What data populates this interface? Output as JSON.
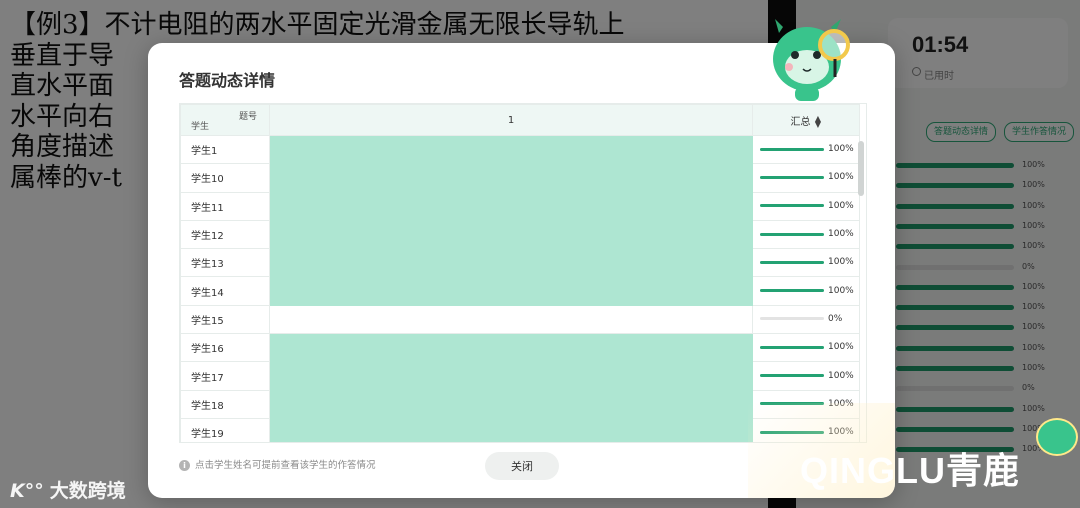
{
  "slide": {
    "text": "【例3】不计电阻的两水平固定光滑金属无限长导轨上\n  垂直于导\n  直水平面\n  水平向右\n  角度描述\n  属棒的v-t"
  },
  "timer": {
    "value": "01:54",
    "label": "已用时"
  },
  "right_panel": {
    "tabs": [
      "答题动态详情",
      "学生作答情况"
    ],
    "rows": [
      {
        "pct": "100%",
        "v": 1
      },
      {
        "pct": "100%",
        "v": 1
      },
      {
        "pct": "100%",
        "v": 1
      },
      {
        "pct": "100%",
        "v": 1
      },
      {
        "pct": "100%",
        "v": 1
      },
      {
        "pct": "0%",
        "v": 0
      },
      {
        "pct": "100%",
        "v": 1
      },
      {
        "pct": "100%",
        "v": 1
      },
      {
        "pct": "100%",
        "v": 1
      },
      {
        "pct": "100%",
        "v": 1
      },
      {
        "pct": "100%",
        "v": 1
      },
      {
        "pct": "0%",
        "v": 0
      },
      {
        "pct": "100%",
        "v": 1
      },
      {
        "pct": "100%",
        "v": 1
      },
      {
        "pct": "100%",
        "v": 1
      }
    ]
  },
  "watermark": {
    "left": "大数跨境",
    "left_logo": "K°°",
    "right": "QINGLU青鹿"
  },
  "modal": {
    "title": "答题动态详情",
    "header": {
      "question_label": "题号",
      "student_label": "学生",
      "question_number": "1",
      "summary_label": "汇总"
    },
    "students": [
      {
        "name": "学生1",
        "answered": true,
        "rate": 1,
        "pct": "100%"
      },
      {
        "name": "学生10",
        "answered": true,
        "rate": 1,
        "pct": "100%"
      },
      {
        "name": "学生11",
        "answered": true,
        "rate": 1,
        "pct": "100%"
      },
      {
        "name": "学生12",
        "answered": true,
        "rate": 1,
        "pct": "100%"
      },
      {
        "name": "学生13",
        "answered": true,
        "rate": 1,
        "pct": "100%"
      },
      {
        "name": "学生14",
        "answered": true,
        "rate": 1,
        "pct": "100%"
      },
      {
        "name": "学生15",
        "answered": false,
        "rate": 0,
        "pct": "0%"
      },
      {
        "name": "学生16",
        "answered": true,
        "rate": 1,
        "pct": "100%"
      },
      {
        "name": "学生17",
        "answered": true,
        "rate": 1,
        "pct": "100%"
      },
      {
        "name": "学生18",
        "answered": true,
        "rate": 1,
        "pct": "100%"
      },
      {
        "name": "学生19",
        "answered": true,
        "rate": 1,
        "pct": "100%"
      }
    ],
    "footer_tip": "点击学生姓名可提前查看该学生的作答情况",
    "close_label": "关闭"
  },
  "colors": {
    "accent": "#23a273",
    "cell_answered": "#aee6d2",
    "tab_border": "#2faa78"
  }
}
